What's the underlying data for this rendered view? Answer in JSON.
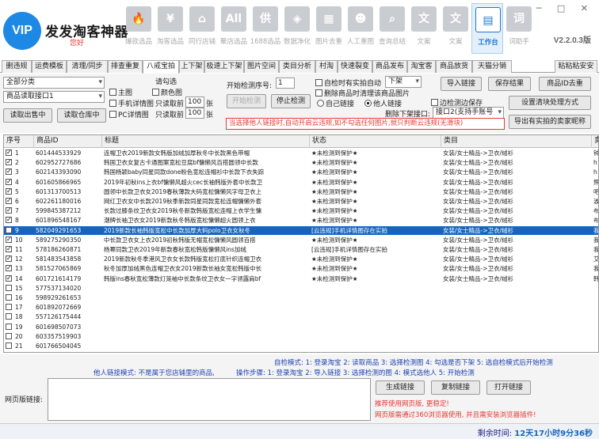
{
  "header": {
    "logo_badge": "VIP",
    "logo_text": "发发淘客神器",
    "user": "您好",
    "version": "V2.2.0.3版",
    "window_controls": "─ □ ✕",
    "nav": [
      {
        "label": "爆款选品",
        "icon": "flame-icon",
        "glyph": "🔥"
      },
      {
        "label": "淘客选品",
        "icon": "yen-icon",
        "glyph": "¥"
      },
      {
        "label": "同行店铺",
        "icon": "store-icon",
        "glyph": "⌂"
      },
      {
        "label": "聚店选品",
        "icon": "all-icon",
        "glyph": "All"
      },
      {
        "label": "1688选品",
        "icon": "supply-icon",
        "glyph": "供"
      },
      {
        "label": "数据净化",
        "icon": "shield-icon",
        "glyph": "◈"
      },
      {
        "label": "图片去重",
        "icon": "image-icon",
        "glyph": "▦"
      },
      {
        "label": "人工重图",
        "icon": "person-icon",
        "glyph": "☻"
      },
      {
        "label": "查询总结",
        "icon": "search-icon",
        "glyph": "⌕"
      },
      {
        "label": "文案",
        "icon": "text-icon",
        "glyph": "文"
      },
      {
        "label": "文案",
        "icon": "text-icon",
        "glyph": "文"
      },
      {
        "label": "工作台",
        "icon": "chart-icon",
        "glyph": "▤",
        "active": true
      },
      {
        "label": "词助手",
        "icon": "word-icon",
        "glyph": "词"
      }
    ]
  },
  "tabs": [
    "删违规",
    "运费模板",
    "清理/同步",
    "排查重复",
    "八戒宝拍",
    "上下架",
    "极速上下架",
    "图片空间",
    "类目分析",
    "村淘",
    "快速裂变",
    "商品发布",
    "淘宝客",
    "商品放货",
    "天猫分销",
    "粘粘粘安安"
  ],
  "active_tab": 4,
  "panel": {
    "category_select": "全部分类",
    "source_select": "商品读取接口1",
    "btn_read_sale": "读取出售中",
    "btn_read_stock": "读取仓库中",
    "pic_options_label": "请勾选",
    "cb_main": "主图",
    "cb_color": "颜色图",
    "cb_mobile": "手机详情图",
    "only_read_prefix1": "只读取前",
    "count1": "100",
    "unit1": "张",
    "cb_pc": "PC详情图",
    "only_read_prefix2": "只读取前",
    "count2": "100",
    "unit2": "张",
    "start_no_label": "开始检测序号:",
    "start_no": "1",
    "btn_start": "开始检测",
    "btn_stop": "停止检测",
    "cb_auto_violate": "自检时有实拍自动",
    "auto_action_select": "下架",
    "cb_delete_img": "删除商品时清理该商品图片",
    "rd_self": "自己链接",
    "rd_other": "他人链接",
    "cb_edit_save": "边检测边保存",
    "delist_label": "删除下架接口:",
    "delist_select": "接口2(支持手账号",
    "btn_import": "导入链接",
    "btn_save": "保存结果",
    "btn_dedup": "商品ID去重",
    "btn_batch": "设置清块处理方式",
    "btn_export": "导出有实拍的卖家昵称",
    "red_note": "当选择他人链接时,自动开启云违规,如不勾选任何图片,就只判断云违规(无滑块)"
  },
  "table": {
    "headers": [
      "序号",
      "商品ID",
      "标题",
      "状态",
      "类目",
      "卖"
    ],
    "rows": [
      {
        "no": "1",
        "checked": true,
        "id": "601444533929",
        "title": "连帽卫衣2019新款女韩版加绒加厚秋冬中长款黑色带帽",
        "status": "★未检测到保护★",
        "cat": "女装/女士精品->卫衣/绒衫",
        "seller": "钟"
      },
      {
        "no": "2",
        "checked": true,
        "id": "602952727686",
        "title": "韩国卫衣女复古卡通图案宽松豆腐bf慵懒风百搭圆领中长款",
        "status": "★未检测到保护★",
        "cat": "女装/女士精品->卫衣/绒衫",
        "seller": "h"
      },
      {
        "no": "3",
        "checked": true,
        "id": "602143393090",
        "title": "韩国杨颖baby同星同款done粉色宽松连帽衫中长款下衣失踪",
        "status": "★未检测到保护★",
        "cat": "女装/女士精品->卫衣/绒衫",
        "seller": "h"
      },
      {
        "no": "4",
        "checked": true,
        "id": "601605866965",
        "title": "2019年初秋ins上衣bf慵懒风超火cec长袖韩版外套中长款卫",
        "status": "★未检测到保护★",
        "cat": "女装/女士精品->卫衣/绒衫",
        "seller": "熊"
      },
      {
        "no": "5",
        "checked": true,
        "id": "601313700513",
        "title": "圆领中长款卫衣女2019春秋薄款大码宽松慵懒风字母卫衣上",
        "status": "★未检测到保护★",
        "cat": "女装/女士精品->卫衣/绒衫",
        "seller": "吧"
      },
      {
        "no": "6",
        "checked": true,
        "id": "602261180016",
        "title": "网红卫衣女中长款2019秋季新款同星同款宽松连帽慵懒外套",
        "status": "★未检测到保护★",
        "cat": "女装/女士精品->卫衣/绒衫",
        "seller": "波"
      },
      {
        "no": "7",
        "checked": true,
        "id": "599845387212",
        "title": "长款过膝条纹卫衣女2019秋冬新款韩版宽松连帽上衣学生慵",
        "status": "★未检测到保护★",
        "cat": "女装/女士精品->卫衣/绒衫",
        "seller": "布"
      },
      {
        "no": "8",
        "checked": true,
        "id": "601896548167",
        "title": "潮牌长袖卫衣女2019新款秋冬韩版宽松慵懒超火圆领上衣",
        "status": "★未检测到保护★",
        "cat": "女装/女士精品->卫衣/绒衫",
        "seller": "布"
      },
      {
        "no": "9",
        "checked": false,
        "selected": true,
        "id": "582049291653",
        "title": "2019新款长袖韩版宽松中长款加厚大码polo卫衣女秋冬",
        "status": "[云违规]手机详情图存在实拍",
        "cat": "女装/女士精品->卫衣/绒衫",
        "seller": "我"
      },
      {
        "no": "10",
        "checked": true,
        "id": "589275290350",
        "title": "中长款卫衣女上衣2019初秋韩版无帽宽松慵懒风圆领百搭",
        "status": "★未检测到保护★",
        "cat": "女装/女士精品->卫衣/绒衫",
        "seller": "我"
      },
      {
        "no": "11",
        "checked": true,
        "id": "578186260871",
        "title": "杨幂同款卫衣2019年新款春秋宽松韩版慵懒风ins加绒",
        "status": "[云违规]手机详情图存在实拍",
        "cat": "女装/女士精品->卫衣/绒衫",
        "seller": "我"
      },
      {
        "no": "12",
        "checked": true,
        "id": "581483543858",
        "title": "2019新款秋冬季港风卫衣女长款韩版宽松打底针织连帽卫衣",
        "status": "★未检测到保护★",
        "cat": "女装/女士精品->卫衣/绒衫",
        "seller": "艾"
      },
      {
        "no": "13",
        "checked": true,
        "id": "581527065869",
        "title": "秋冬加厚加绒黑色连帽卫衣女2019新款长袖女宽松韩版中长",
        "status": "★未检测到保护★",
        "cat": "女装/女士精品->卫衣/绒衫",
        "seller": "我"
      },
      {
        "no": "14",
        "checked": true,
        "id": "601721614179",
        "title": "韩版ins春秋宽松薄款灯笼袖中长款条纹卫衣女一字领露肩bf",
        "status": "★未检测到保护★",
        "cat": "女装/女士精品->卫衣/绒衫",
        "seller": "韩"
      },
      {
        "no": "15",
        "checked": false,
        "id": "577537134020",
        "title": "",
        "status": "",
        "cat": "",
        "seller": ""
      },
      {
        "no": "16",
        "checked": false,
        "id": "598929261653",
        "title": "",
        "status": "",
        "cat": "",
        "seller": ""
      },
      {
        "no": "17",
        "checked": false,
        "id": "601892072669",
        "title": "",
        "status": "",
        "cat": "",
        "seller": ""
      },
      {
        "no": "18",
        "checked": false,
        "id": "557126175444",
        "title": "",
        "status": "",
        "cat": "",
        "seller": ""
      },
      {
        "no": "19",
        "checked": false,
        "id": "601698507073",
        "title": "",
        "status": "",
        "cat": "",
        "seller": ""
      },
      {
        "no": "20",
        "checked": false,
        "id": "603357519903",
        "title": "",
        "status": "",
        "cat": "",
        "seller": ""
      },
      {
        "no": "21",
        "checked": false,
        "id": "601766504045",
        "title": "",
        "status": "",
        "cat": "",
        "seller": ""
      }
    ]
  },
  "bottom": {
    "mode1": "自检模式: 1: 登录淘宝 2: 读取商品 3: 选择检测图 4: 勾选是否下架 5: 选自检模式后开始检测",
    "mode2": "他人链接模式: 不是属于您店铺里的商品,",
    "mode3": "操作步骤: 1: 登录淘宝 2: 导入链接 3: 选择检测的图 4: 模式选他人 5: 开始检测",
    "web_label": "网页版链接:",
    "btn_gen": "生成链接",
    "btn_copy": "复制链接",
    "btn_open": "打开链接",
    "warn1": "推荐使用网页版, 更稳定!",
    "warn2": "网页版需通过360浏览器使用, 并且需安装浏览器插件!",
    "remain_label": "剩余时间:",
    "remain_value": "12天17小时9分36秒"
  },
  "colors": {
    "accent": "#1565c0",
    "warn": "#e53935",
    "info": "#1a3fb0"
  }
}
